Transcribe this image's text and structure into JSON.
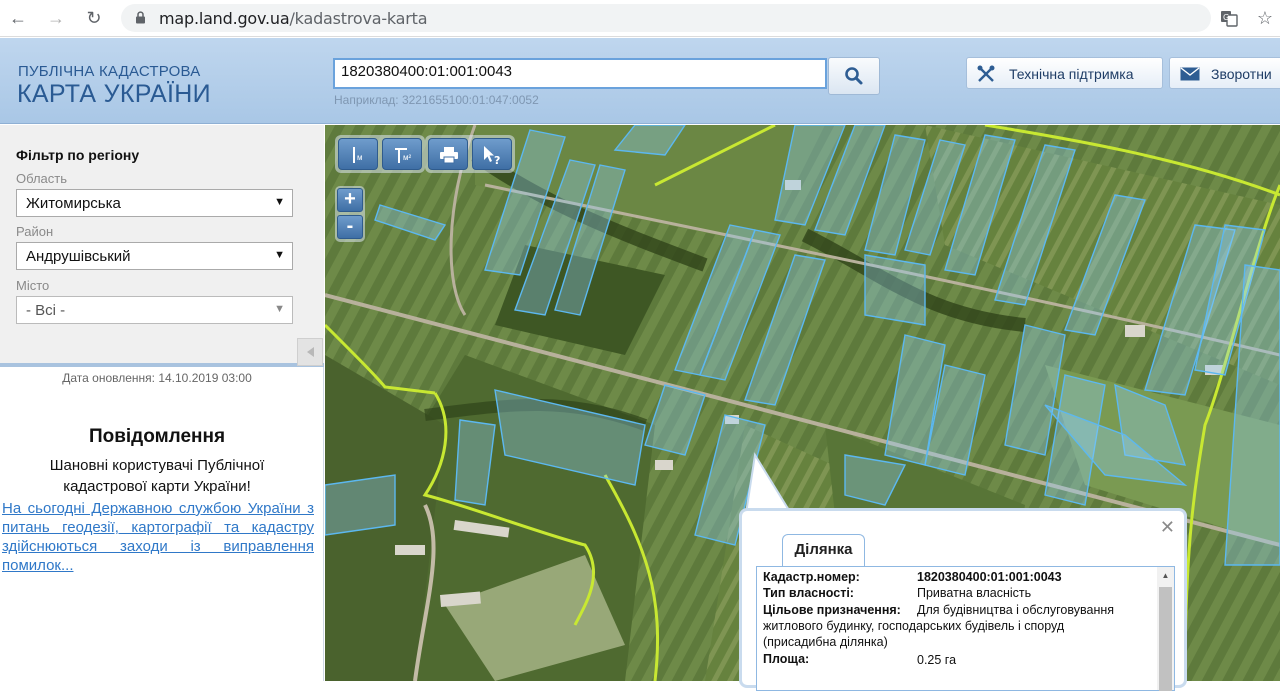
{
  "browser": {
    "url_domain": "map.land.gov.ua",
    "url_path": "/kadastrova-karta"
  },
  "header": {
    "logo_line1": "ПУБЛІЧНА КАДАСТРОВА",
    "logo_line2": "КАРТА УКРАЇНИ",
    "search_value": "1820380400:01:001:0043",
    "search_hint": "Наприклад: 3221655100:01:047:0052",
    "support_label": "Технічна підтримка",
    "feedback_label": "Зворотни"
  },
  "sidebar": {
    "filter_title": "Фільтр по регіону",
    "region_label": "Область",
    "region_value": "Житомирська",
    "district_label": "Район",
    "district_value": "Андрушівський",
    "city_label": "Місто",
    "city_value": "- Всі -",
    "update_date": "Дата оновлення: 14.10.2019 03:00",
    "notice_title": "Повідомлення",
    "notice_text": "Шановні користувачі Публічної кадастрової карти України!",
    "notice_link": "На сьогодні Державною службою України з питань геодезії, картографії та кадастру здійснюються заходи із виправлення помилок..."
  },
  "map": {
    "tool_units": [
      "м",
      "м²"
    ]
  },
  "popup": {
    "tab_label": "Ділянка",
    "rows": [
      {
        "key": "Кадастр.номер:",
        "value": "1820380400:01:001:0043"
      },
      {
        "key": "Тип власності:",
        "value": "Приватна власність"
      },
      {
        "key": "Цільове призначення:",
        "value": "Для будівництва і обслуговування"
      },
      {
        "key": "Площа:",
        "value": "0.25 га"
      }
    ],
    "purpose_cont1": "житлового будинку, господарських будівель і споруд",
    "purpose_cont2": "(присадибна ділянка)"
  },
  "colors": {
    "parcel_outline": "#5cb8f0",
    "boundary_line": "#c8e832",
    "header_text": "#2a5a93",
    "link": "#2f78c8"
  }
}
